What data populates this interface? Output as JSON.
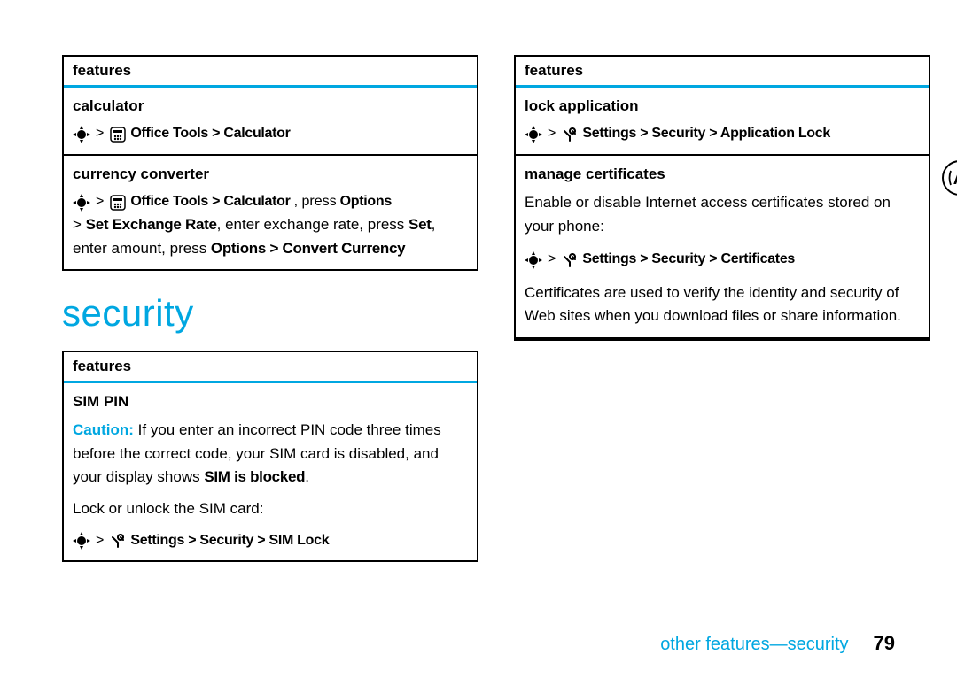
{
  "left": {
    "table1": {
      "header": "features",
      "row1": {
        "title": "calculator",
        "path": "Office Tools > Calculator"
      },
      "row2": {
        "title": "currency converter",
        "path_a": "Office Tools > Calculator",
        "path_a_tail": ", press ",
        "opt": "Options",
        "line2_a": "> ",
        "line2_b": "Set Exchange Rate",
        "line2_c": ", enter exchange rate, press ",
        "line2_d": "Set",
        "line2_e": ",",
        "line3_a": "enter amount, press ",
        "line3_b": "Options > Convert Currency"
      }
    },
    "heading": "security",
    "table2": {
      "header": "features",
      "row1": {
        "title": "SIM PIN",
        "caution_label": "Caution:",
        "caution_text": " If you enter an incorrect PIN code three times before the correct code, your SIM card is disabled, and your display shows ",
        "caution_bold": "SIM is blocked",
        "caution_end": ".",
        "body2": "Lock or unlock the SIM card:",
        "path": "Settings > Security > SIM Lock"
      }
    }
  },
  "right": {
    "table1": {
      "header": "features",
      "row1": {
        "title": "lock application",
        "path": "Settings > Security > Application Lock"
      },
      "row2": {
        "title": "manage certificates",
        "body1": "Enable or disable Internet access certificates stored on your phone:",
        "path": "Settings > Security > Certificates",
        "body2": "Certificates are used to verify the identity and security of Web sites when you download files or share information."
      }
    }
  },
  "footer": {
    "text": "other features—security",
    "page": "79"
  }
}
